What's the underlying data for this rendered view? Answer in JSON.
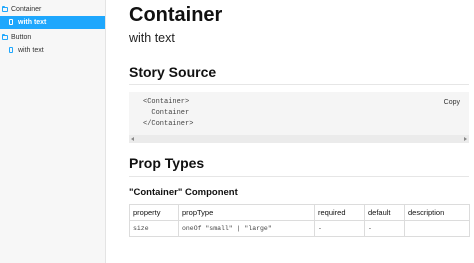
{
  "sidebar": {
    "groups": [
      {
        "label": "Container",
        "stories": [
          {
            "label": "with text",
            "selected": true
          }
        ]
      },
      {
        "label": "Button",
        "stories": [
          {
            "label": "with text",
            "selected": false
          }
        ]
      }
    ]
  },
  "story": {
    "title": "Container",
    "subtitle": "with text"
  },
  "source": {
    "heading": "Story Source",
    "lines": [
      "<Container>",
      "  Container",
      "</Container>"
    ],
    "copy_label": "Copy"
  },
  "props": {
    "heading": "Prop Types",
    "component_label": "\"Container\" Component",
    "columns": [
      "property",
      "propType",
      "required",
      "default",
      "description"
    ],
    "rows": [
      [
        "size",
        "oneOf \"small\" | \"large\"",
        "-",
        "-",
        ""
      ]
    ]
  },
  "colors": {
    "accent": "#1ea7fd",
    "sidebar_bg": "#f7f7f7",
    "code_bg": "#f5f5f5"
  }
}
